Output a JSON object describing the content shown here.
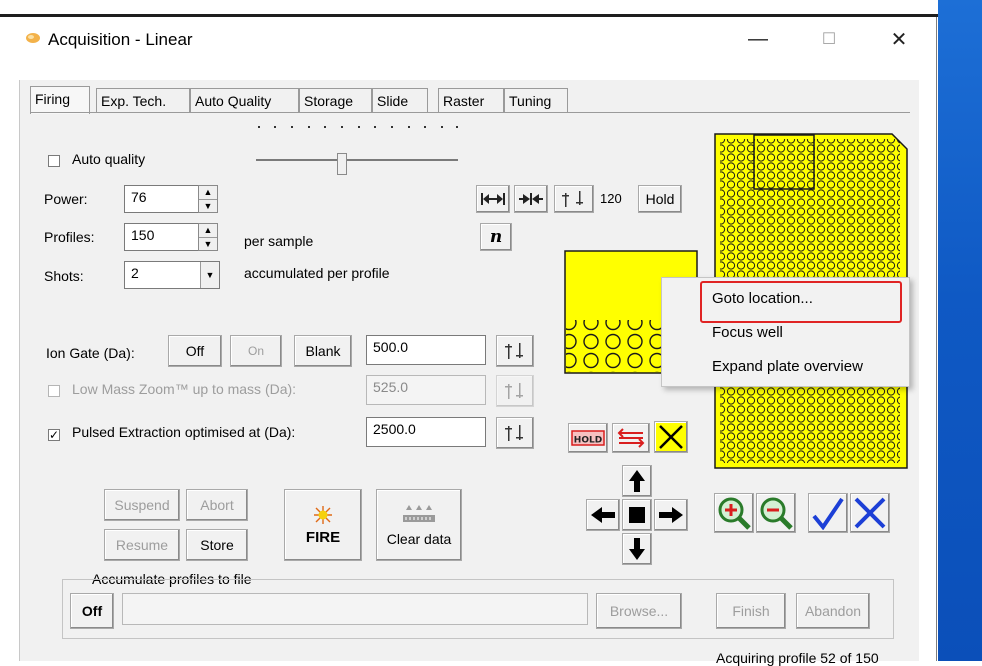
{
  "window": {
    "title": "Acquisition - Linear",
    "min_label": "—",
    "max_label": "☐",
    "close_label": "✕"
  },
  "tabs": [
    "Firing",
    "Exp. Tech.",
    "Auto Quality",
    "Storage",
    "Slide",
    "Raster",
    "Tuning"
  ],
  "firing": {
    "auto_quality_label": "Auto quality",
    "power_label": "Power:",
    "power_value": "76",
    "profiles_label": "Profiles:",
    "profiles_value": "150",
    "per_sample_label": "per sample",
    "shots_label": "Shots:",
    "shots_value": "2",
    "accumulated_label": "accumulated per profile",
    "ion_gate_label": "Ion Gate (Da):",
    "off_label": "Off",
    "on_label": "On",
    "blank_label": "Blank",
    "ion_gate_value": "500.0",
    "low_mass_label": "Low Mass Zoom™ up to mass (Da):",
    "low_mass_value": "525.0",
    "pulsed_label": "Pulsed Extraction optimised at (Da):",
    "pulsed_value": "2500.0",
    "value_120": "120",
    "hold_label": "Hold",
    "n_label": "n",
    "suspend_label": "Suspend",
    "abort_label": "Abort",
    "resume_label": "Resume",
    "store_label": "Store",
    "fire_label": "FIRE",
    "clear_label": "Clear data",
    "hold_icon_text": "HOLD"
  },
  "accumulate": {
    "group_label": "Accumulate profiles to file",
    "off_label": "Off",
    "path_value": "",
    "browse_label": "Browse...",
    "finish_label": "Finish",
    "abandon_label": "Abandon"
  },
  "context_menu": {
    "items": [
      "Goto location...",
      "Focus well",
      "Expand plate overview"
    ]
  },
  "status": "Acquiring profile 52 of 150",
  "colors": {
    "plate": "#ffff00",
    "highlight": "#e02424",
    "accent_blue": "#1c3fd6",
    "zoom_green": "#2a7b2a",
    "red_icon": "#d91e1e"
  }
}
